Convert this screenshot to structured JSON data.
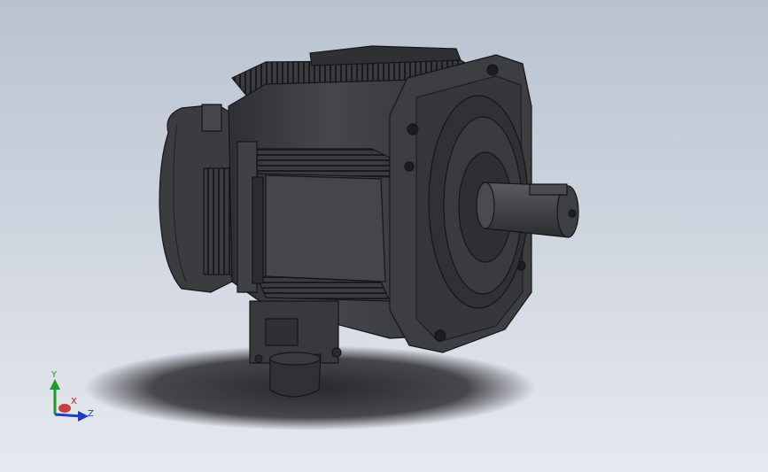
{
  "viewport": {
    "background_top": "#b9c2d0",
    "background_bottom": "#e6e9ef"
  },
  "model": {
    "body_color": "#3f4044",
    "edge_color": "#161618",
    "shadow_color": "#2b2c30"
  },
  "triad": {
    "y_label": "Y",
    "x_label": "X",
    "z_label": "Z",
    "y_color": "#1c9a2a",
    "x_color": "#c02020",
    "z_color": "#1f3fb8"
  }
}
